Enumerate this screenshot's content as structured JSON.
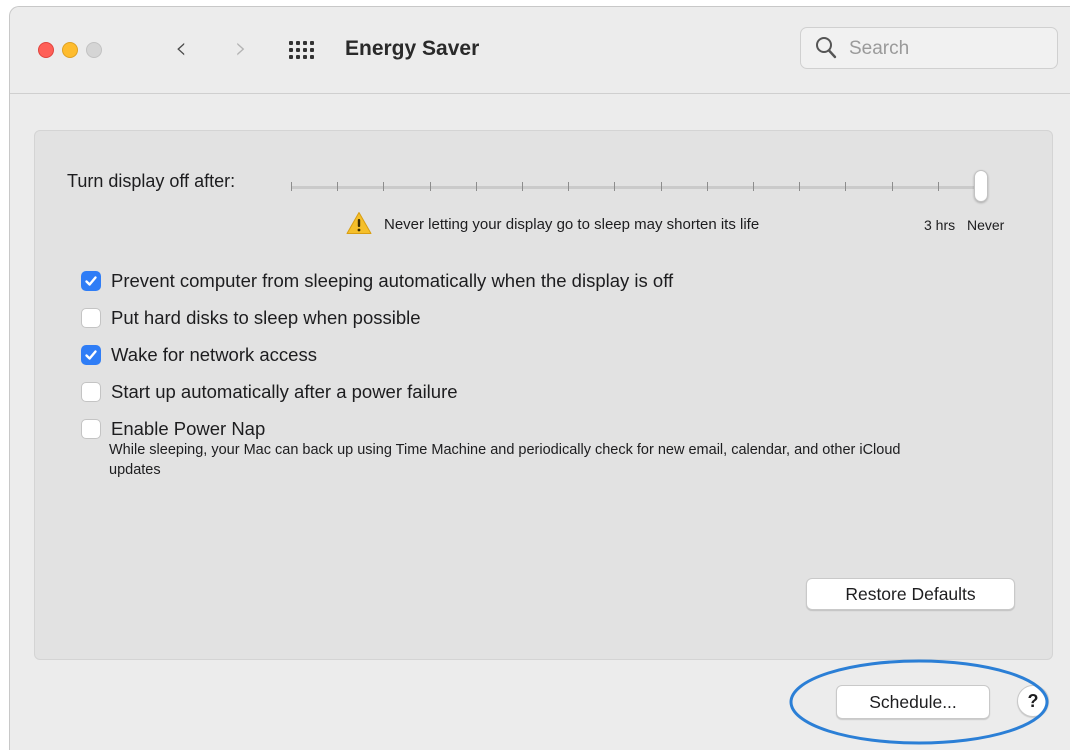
{
  "window": {
    "title": "Energy Saver",
    "nav": {
      "back": "‹",
      "forward": "›"
    }
  },
  "search": {
    "placeholder": "Search",
    "value": ""
  },
  "display_sleep": {
    "label": "Turn display off after:",
    "value": "Never",
    "scale": {
      "near_end": "3 hrs",
      "end": "Never"
    },
    "warning": "Never letting your display go to sleep may shorten its life"
  },
  "options": [
    {
      "label": "Prevent computer from sleeping automatically when the display is off",
      "checked": true
    },
    {
      "label": "Put hard disks to sleep when possible",
      "checked": false
    },
    {
      "label": "Wake for network access",
      "checked": true
    },
    {
      "label": "Start up automatically after a power failure",
      "checked": false
    },
    {
      "label": "Enable Power Nap",
      "checked": false
    }
  ],
  "power_nap_description": "While sleeping, your Mac can back up using Time Machine and periodically check for new email, calendar, and other iCloud updates",
  "buttons": {
    "restore_defaults": "Restore Defaults",
    "schedule": "Schedule...",
    "help": "?"
  },
  "colors": {
    "accent": "#2f7df6",
    "annotation": "#2b7fd6",
    "close": "#fe5f57",
    "minimize": "#febc2e",
    "zoom": "#d5d5d5"
  },
  "icons": {
    "search": "magnifying-glass-icon",
    "grid": "grid-icon",
    "warning": "warning-triangle-icon"
  }
}
